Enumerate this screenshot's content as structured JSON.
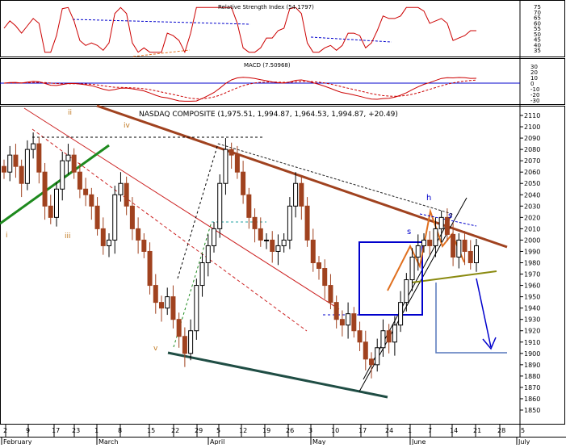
{
  "panels": {
    "rsi_title": "Relative Strength Index (54.1797)",
    "macd_title": "MACD (7.50968)",
    "price_title": "NASDAQ COMPOSITE (1,975.51, 1,994.87, 1,964.53, 1,994.87, +20.49)"
  },
  "rsi_ticks": [
    "75",
    "70",
    "65",
    "60",
    "55",
    "50",
    "45",
    "40",
    "35"
  ],
  "macd_ticks": [
    "30",
    "20",
    "10",
    "0",
    "-10",
    "-20",
    "-30"
  ],
  "price_ticks": [
    "2110",
    "2100",
    "2090",
    "2080",
    "2070",
    "2060",
    "2050",
    "2040",
    "2030",
    "2020",
    "2010",
    "2000",
    "1990",
    "1980",
    "1970",
    "1960",
    "1950",
    "1940",
    "1930",
    "1920",
    "1910",
    "1900",
    "1890",
    "1880",
    "1870",
    "1860",
    "1850"
  ],
  "x_day_ticks": [
    "2",
    "9",
    "17",
    "23",
    "1",
    "8",
    "15",
    "22",
    "29",
    "5",
    "12",
    "19",
    "26",
    "3",
    "10",
    "17",
    "24",
    "1",
    "7",
    "14",
    "21",
    "28",
    "5"
  ],
  "x_month_labels": [
    "February",
    "March",
    "April",
    "May",
    "June",
    "July"
  ],
  "annotations": {
    "wave_i": "i",
    "wave_ii": "ii",
    "wave_iii": "iii",
    "wave_iv": "iv",
    "wave_v": "v",
    "label_h": "h",
    "label_s_left": "s",
    "label_s_right": "s"
  },
  "colors": {
    "up": "#000000",
    "down": "#a0421f",
    "rsi": "#cc0000",
    "macd": "#cc0000",
    "blue": "#0000cc",
    "downtrend": "#a0421f",
    "green_trend": "#1e8a1e",
    "dark_base": "#1f4d44",
    "orange": "#e07020",
    "olive": "#8a8a10"
  },
  "chart_data": {
    "type": "candlestick",
    "title": "NASDAQ COMPOSITE (1,975.51, 1,994.87, 1,964.53, 1,994.87, +20.49)",
    "ylim": [
      1845,
      2115
    ],
    "last_bar": {
      "open": 1975.51,
      "high": 1994.87,
      "low": 1964.53,
      "close": 1994.87,
      "change": 20.49
    },
    "approx_closes": [
      2060,
      2075,
      2065,
      2050,
      2080,
      2085,
      2060,
      2030,
      2020,
      2045,
      2070,
      2075,
      2060,
      2045,
      2040,
      2030,
      2010,
      1995,
      2000,
      2040,
      2050,
      2030,
      2010,
      2000,
      1990,
      1960,
      1945,
      1940,
      1950,
      1930,
      1915,
      1900,
      1920,
      1960,
      1980,
      1995,
      2010,
      2050,
      2080,
      2075,
      2060,
      2040,
      2020,
      2010,
      2000,
      2000,
      1990,
      1995,
      2000,
      2030,
      2050,
      2030,
      2000,
      1980,
      1975,
      1960,
      1945,
      1930,
      1925,
      1935,
      1920,
      1910,
      1895,
      1890,
      1905,
      1920,
      1910,
      1925,
      1945,
      1965,
      1985,
      1995,
      2000,
      1995,
      2010,
      2020,
      2005,
      1985,
      2000,
      1990,
      1980,
      1995
    ],
    "rsi_ylim": [
      30,
      80
    ],
    "macd_ylim": [
      -35,
      35
    ]
  }
}
